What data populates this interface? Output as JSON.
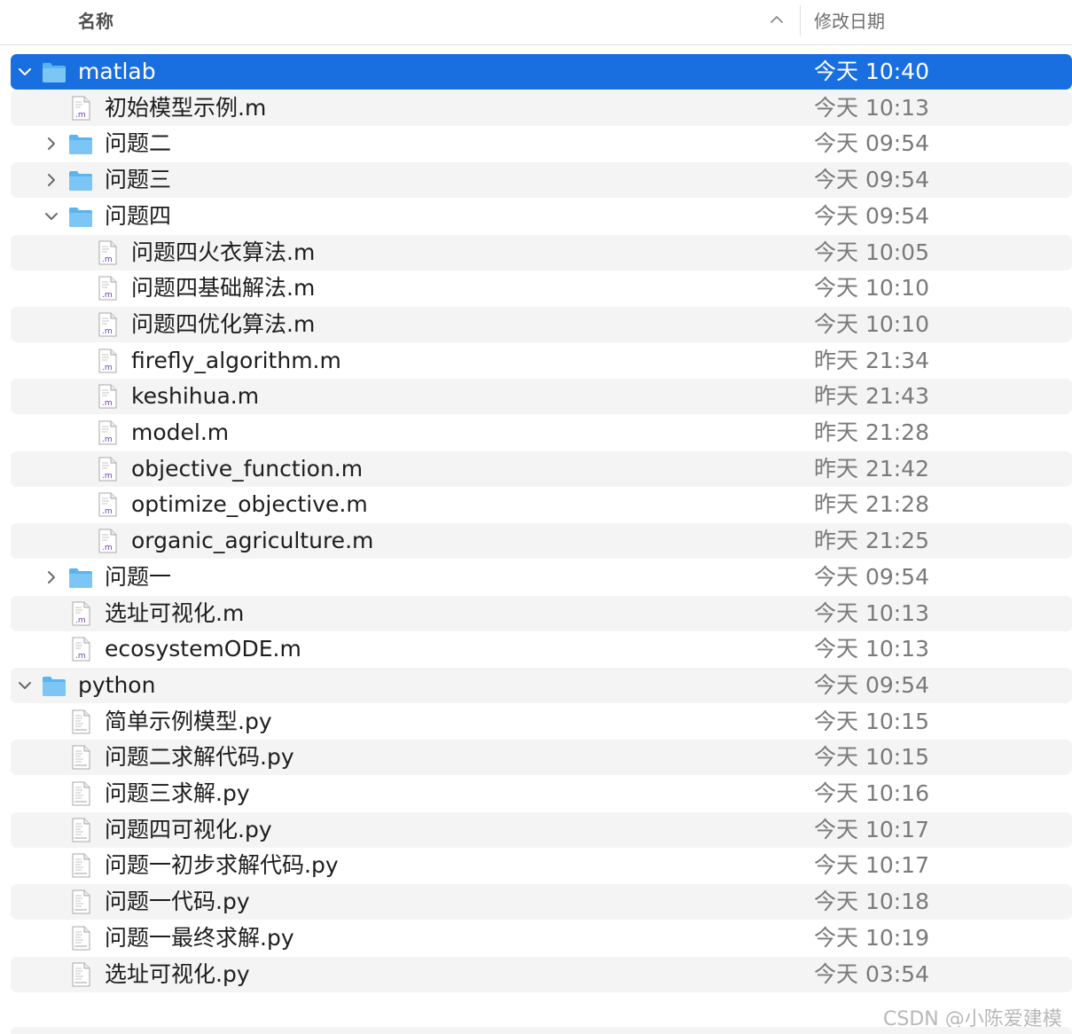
{
  "header": {
    "name_label": "名称",
    "date_label": "修改日期",
    "sort_icon": "chevron-up-icon"
  },
  "colors": {
    "selection": "#1a6fe0",
    "folder": "#5ab4f0",
    "alt_row": "#f4f4f4",
    "m_badge": "#6a3fb0"
  },
  "rows": [
    {
      "name": "matlab",
      "date": "今天 10:40",
      "kind": "folder",
      "depth": 0,
      "expanded": true,
      "selected": true
    },
    {
      "name": "初始模型示例.m",
      "date": "今天 10:13",
      "kind": "m",
      "depth": 1
    },
    {
      "name": "问题二",
      "date": "今天 09:54",
      "kind": "folder",
      "depth": 1,
      "expanded": false
    },
    {
      "name": "问题三",
      "date": "今天 09:54",
      "kind": "folder",
      "depth": 1,
      "expanded": false
    },
    {
      "name": "问题四",
      "date": "今天 09:54",
      "kind": "folder",
      "depth": 1,
      "expanded": true
    },
    {
      "name": "问题四火衣算法.m",
      "date": "今天 10:05",
      "kind": "m",
      "depth": 2
    },
    {
      "name": "问题四基础解法.m",
      "date": "今天 10:10",
      "kind": "m",
      "depth": 2
    },
    {
      "name": "问题四优化算法.m",
      "date": "今天 10:10",
      "kind": "m",
      "depth": 2
    },
    {
      "name": "firefly_algorithm.m",
      "date": "昨天 21:34",
      "kind": "m",
      "depth": 2
    },
    {
      "name": "keshihua.m",
      "date": "昨天 21:43",
      "kind": "m",
      "depth": 2
    },
    {
      "name": "model.m",
      "date": "昨天 21:28",
      "kind": "m",
      "depth": 2
    },
    {
      "name": "objective_function.m",
      "date": "昨天 21:42",
      "kind": "m",
      "depth": 2
    },
    {
      "name": "optimize_objective.m",
      "date": "昨天 21:28",
      "kind": "m",
      "depth": 2
    },
    {
      "name": "organic_agriculture.m",
      "date": "昨天 21:25",
      "kind": "m",
      "depth": 2
    },
    {
      "name": "问题一",
      "date": "今天 09:54",
      "kind": "folder",
      "depth": 1,
      "expanded": false
    },
    {
      "name": "选址可视化.m",
      "date": "今天 10:13",
      "kind": "m",
      "depth": 1
    },
    {
      "name": "ecosystemODE.m",
      "date": "今天 10:13",
      "kind": "m",
      "depth": 1
    },
    {
      "name": "python",
      "date": "今天 09:54",
      "kind": "folder",
      "depth": 0,
      "expanded": true
    },
    {
      "name": "简单示例模型.py",
      "date": "今天 10:15",
      "kind": "py",
      "depth": 1
    },
    {
      "name": "问题二求解代码.py",
      "date": "今天 10:15",
      "kind": "py",
      "depth": 1
    },
    {
      "name": "问题三求解.py",
      "date": "今天 10:16",
      "kind": "py",
      "depth": 1
    },
    {
      "name": "问题四可视化.py",
      "date": "今天 10:17",
      "kind": "py",
      "depth": 1
    },
    {
      "name": "问题一初步求解代码.py",
      "date": "今天 10:17",
      "kind": "py",
      "depth": 1
    },
    {
      "name": "问题一代码.py",
      "date": "今天 10:18",
      "kind": "py",
      "depth": 1
    },
    {
      "name": "问题一最终求解.py",
      "date": "今天 10:19",
      "kind": "py",
      "depth": 1
    },
    {
      "name": "选址可视化.py",
      "date": "今天 03:54",
      "kind": "py",
      "depth": 1
    }
  ],
  "watermark": "CSDN @小陈爱建模"
}
